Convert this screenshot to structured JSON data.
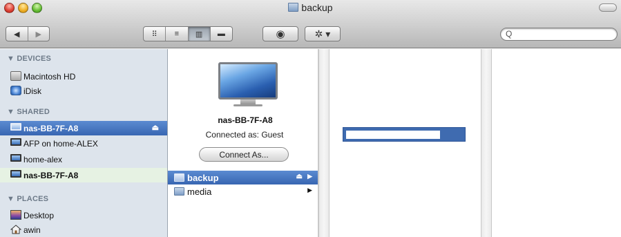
{
  "window": {
    "title": "backup",
    "search_placeholder": "",
    "search_glyph": "Q"
  },
  "toolbar": {
    "back_glyph": "◀",
    "forward_glyph": "▶",
    "view_icon_glyph": "⠿",
    "view_list_glyph": "≡",
    "view_column_glyph": "▥",
    "view_coverflow_glyph": "▬",
    "quicklook_glyph": "◉",
    "action_glyph": "✲ ▾"
  },
  "sidebar": {
    "devices_header": "▼ DEVICES",
    "shared_header": "▼ SHARED",
    "places_header": "▼ PLACES",
    "devices": [
      {
        "label": "Macintosh HD",
        "icon": "hard-drive-icon"
      },
      {
        "label": "iDisk",
        "icon": "idisk-icon"
      }
    ],
    "shared": [
      {
        "label": "nas-BB-7F-A8",
        "icon": "monitor-icon",
        "selected": true,
        "eject": "⏏"
      },
      {
        "label": "AFP on home-ALEX",
        "icon": "monitor-icon"
      },
      {
        "label": "home-alex",
        "icon": "monitor-icon"
      },
      {
        "label": "nas-BB-7F-A8",
        "icon": "monitor-icon"
      }
    ],
    "places": [
      {
        "label": "Desktop",
        "icon": "desktop-icon"
      },
      {
        "label": "awin",
        "icon": "home-icon"
      }
    ]
  },
  "column1": {
    "server_name": "nas-BB-7F-A8",
    "connected_as": "Connected as: Guest",
    "connect_button": "Connect As...",
    "items": [
      {
        "label": "backup",
        "selected": true,
        "eject": "⏏",
        "arrow": "▶"
      },
      {
        "label": "media",
        "selected": false,
        "arrow": "▶"
      }
    ]
  },
  "colors": {
    "selection": "#3866b2",
    "sidebar_bg": "#dde4ec",
    "loading_bar": "#3f6bb0"
  }
}
